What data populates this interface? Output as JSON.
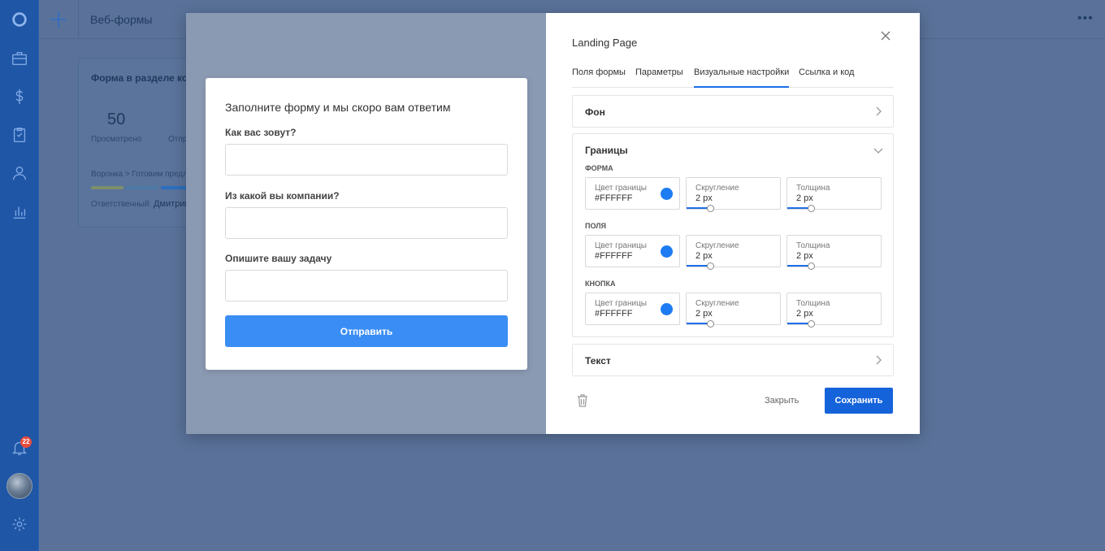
{
  "app": {
    "title": "Веб-формы",
    "notification_count": "22"
  },
  "background_card": {
    "title": "Форма в разделе кон",
    "stat_value": "50",
    "stat_label_1": "Просмотрено",
    "stat_label_2": "Отпр",
    "pipeline": "Воронка > Готовим предло",
    "responsible_label": "Ответственный:",
    "responsible_name": "Дмитрий"
  },
  "preview_form": {
    "title": "Заполните форму и мы скоро вам ответим",
    "fields": [
      {
        "label": "Как вас зовут?"
      },
      {
        "label": "Из какой вы компании?"
      },
      {
        "label": "Опишите вашу задачу"
      }
    ],
    "submit_label": "Отправить"
  },
  "settings": {
    "title": "Landing Page",
    "tabs": [
      {
        "label": "Поля формы",
        "active": false
      },
      {
        "label": "Параметры",
        "active": false
      },
      {
        "label": "Визуальные настройки",
        "active": true
      },
      {
        "label": "Ссылка и код",
        "active": false
      }
    ],
    "sections": {
      "background": {
        "title": "Фон",
        "expanded": false
      },
      "borders": {
        "title": "Границы",
        "expanded": true,
        "groups": [
          {
            "label": "ФОРМА",
            "color_label": "Цвет границы",
            "color_value": "#FFFFFF",
            "radius_label": "Скругление",
            "radius_value": "2 px",
            "width_label": "Толщина",
            "width_value": "2 px"
          },
          {
            "label": "ПОЛЯ",
            "color_label": "Цвет границы",
            "color_value": "#FFFFFF",
            "radius_label": "Скругление",
            "radius_value": "2 px",
            "width_label": "Толщина",
            "width_value": "2 px"
          },
          {
            "label": "КНОПКА",
            "color_label": "Цвет границы",
            "color_value": "#FFFFFF",
            "radius_label": "Скругление",
            "radius_value": "2 px",
            "width_label": "Толщина",
            "width_value": "2 px"
          }
        ]
      },
      "text": {
        "title": "Текст",
        "expanded": false
      }
    },
    "close_label": "Закрыть",
    "save_label": "Сохранить"
  },
  "colors": {
    "sidebar": "#1f56a6",
    "accent": "#1e6ee8",
    "submit_button": "#3a8df5",
    "swatch": "#1e7cf2"
  },
  "icons": [
    "logo-icon",
    "briefcase-icon",
    "dollar-icon",
    "clipboard-check-icon",
    "user-icon",
    "bar-chart-icon",
    "bell-icon",
    "gear-icon",
    "plus-icon",
    "more-icon",
    "close-icon",
    "chevron-right-icon",
    "chevron-down-icon",
    "trash-icon"
  ]
}
